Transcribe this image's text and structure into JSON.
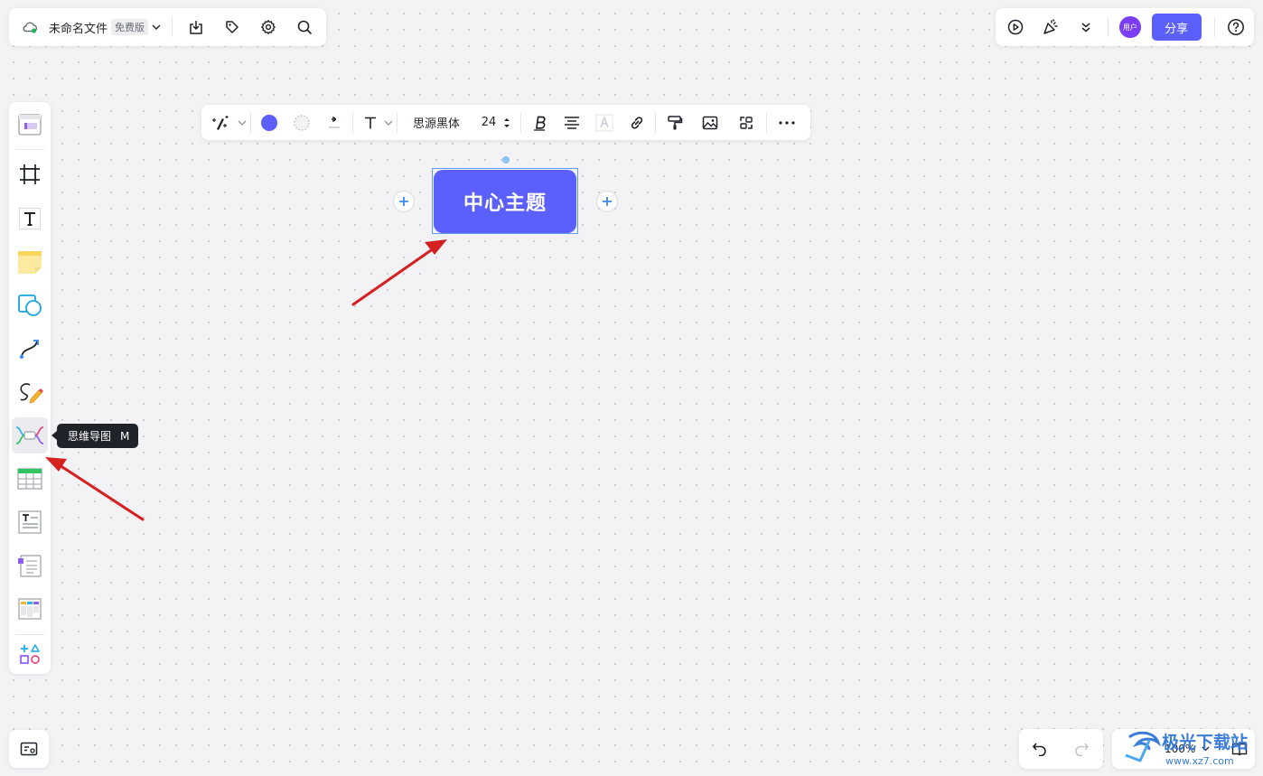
{
  "file": {
    "title": "未命名文件",
    "plan_badge": "免费版"
  },
  "header": {
    "share_label": "分享",
    "avatar_text": "用户"
  },
  "format_toolbar": {
    "font_family": "思源黑体",
    "font_size": "24",
    "fill_color": "#5b5ffb"
  },
  "node": {
    "text": "中心主题"
  },
  "tooltip": {
    "label": "思维导图",
    "shortcut": "M"
  },
  "zoom": {
    "level": "100%"
  },
  "watermark": {
    "text": "极光下载站",
    "url": "www.xz7.com"
  },
  "colors": {
    "accent": "#5b5ffb",
    "annotation_arrow": "#d42020",
    "selection": "#5b9ef5"
  },
  "left_toolbar": {
    "items": [
      "template-icon",
      "frame-icon",
      "text-icon",
      "sticky-note-icon",
      "shape-icon",
      "connector-icon",
      "pen-icon",
      "mindmap-icon",
      "table-icon",
      "text-card-icon",
      "document-card-icon",
      "kanban-icon",
      "more-shapes-icon"
    ],
    "active": "mindmap-icon"
  }
}
